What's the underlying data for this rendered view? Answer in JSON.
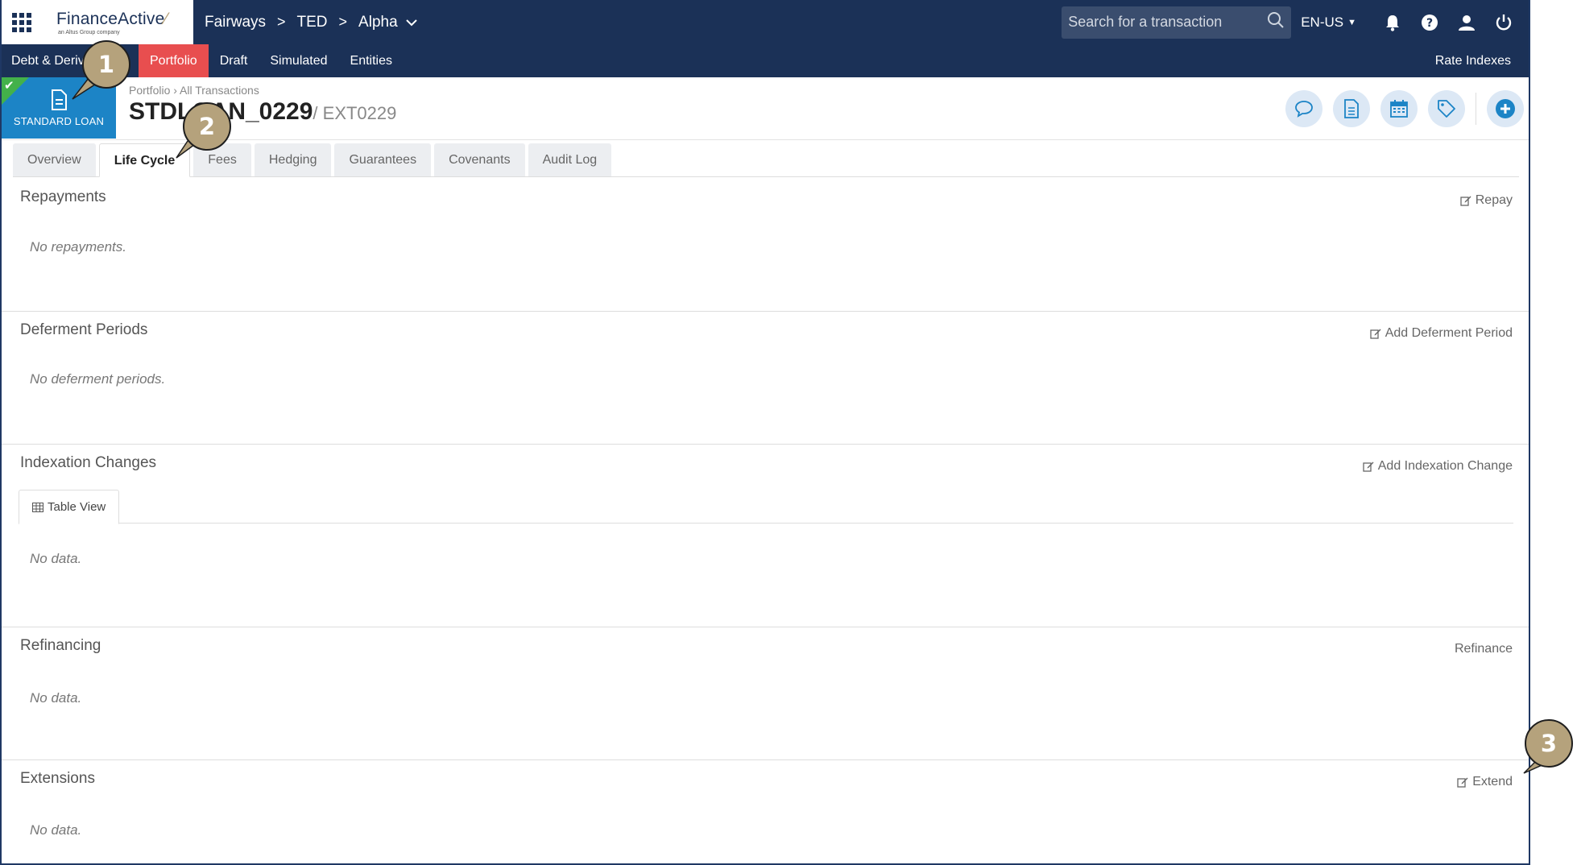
{
  "topbar": {
    "logo_brand": "FinanceActive",
    "logo_sub": "an Altus Group company",
    "breadcrumb": [
      "Fairways",
      "TED",
      "Alpha"
    ],
    "search_placeholder": "Search for a transaction",
    "language": "EN-US"
  },
  "subnav": {
    "module": "Debt & Deriv",
    "items": [
      "Portfolio",
      "Draft",
      "Simulated",
      "Entities"
    ],
    "active": "Portfolio",
    "right_link": "Rate Indexes"
  },
  "header": {
    "type_label": "STANDARD LOAN",
    "breadcrumb": "Portfolio › All Transactions",
    "title": "STDLOAN_0229",
    "external_id": "/ EXT0229"
  },
  "tabs": {
    "items": [
      "Overview",
      "Life Cycle",
      "Fees",
      "Hedging",
      "Guarantees",
      "Covenants",
      "Audit Log"
    ],
    "active": "Life Cycle"
  },
  "sections": {
    "repayments": {
      "title": "Repayments",
      "action": "Repay",
      "empty": "No repayments."
    },
    "deferment": {
      "title": "Deferment Periods",
      "action": "Add Deferment Period",
      "empty": "No deferment periods."
    },
    "indexation": {
      "title": "Indexation Changes",
      "action": "Add Indexation Change",
      "subtab": "Table View",
      "empty": "No data."
    },
    "refinancing": {
      "title": "Refinancing",
      "action": "Refinance",
      "empty": "No data."
    },
    "extensions": {
      "title": "Extensions",
      "action": "Extend",
      "empty": "No data."
    }
  },
  "callouts": [
    "1",
    "2",
    "3"
  ],
  "colors": {
    "navy": "#1b3157",
    "active_tab_red": "#e84e4f",
    "badge_blue": "#1c84c6",
    "check_green": "#43b14a",
    "callout_gold": "#b5a27c"
  }
}
